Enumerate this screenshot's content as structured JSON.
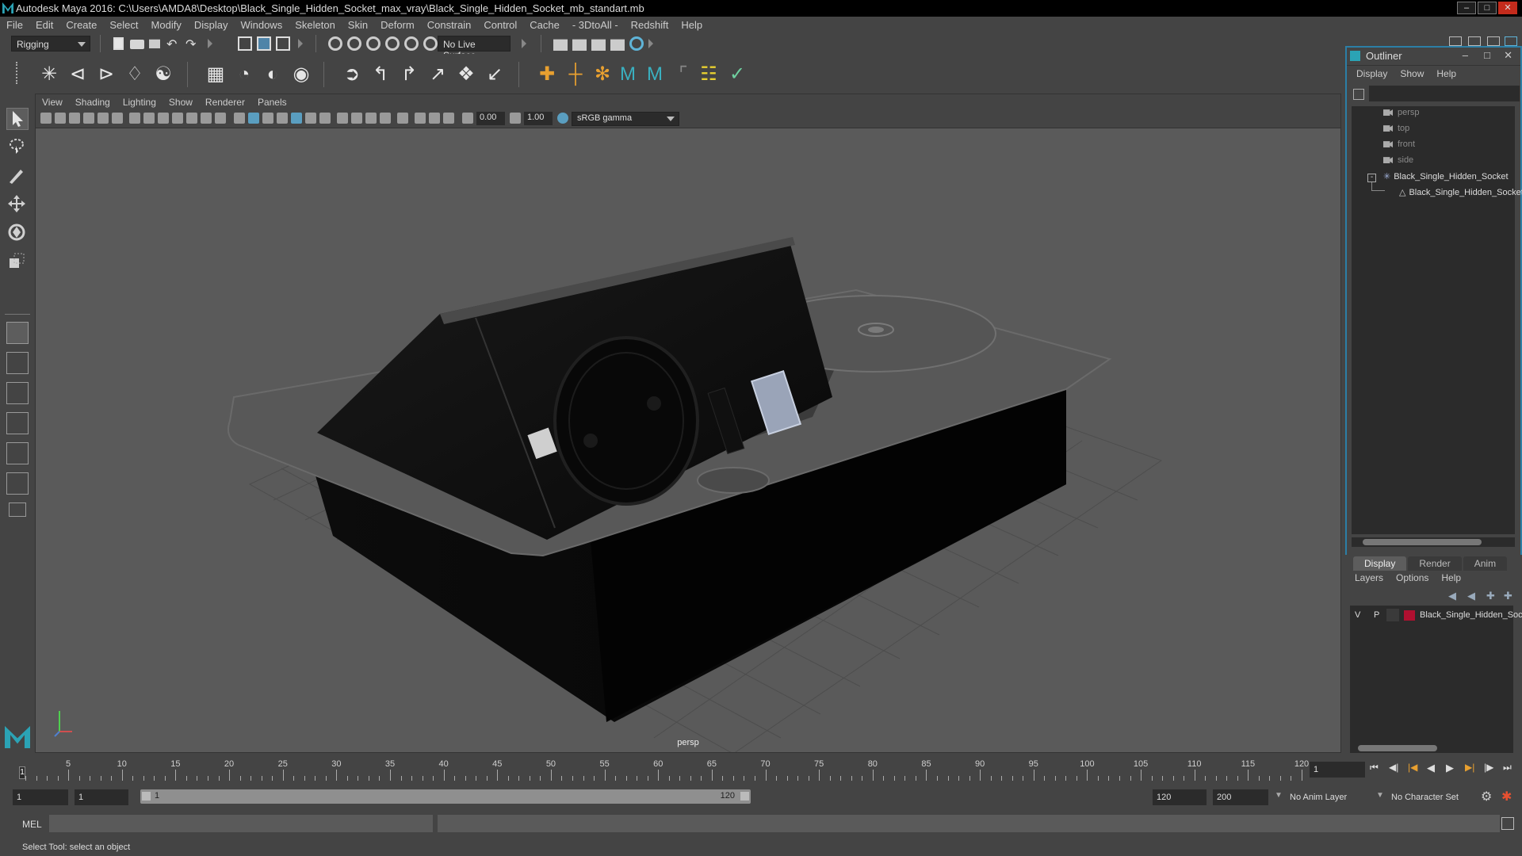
{
  "window": {
    "title": "Autodesk Maya 2016: C:\\Users\\AMDA8\\Desktop\\Black_Single_Hidden_Socket_max_vray\\Black_Single_Hidden_Socket_mb_standart.mb",
    "controls": [
      "–",
      "□",
      "✕"
    ]
  },
  "menubar": [
    "File",
    "Edit",
    "Create",
    "Select",
    "Modify",
    "Display",
    "Windows",
    "Skeleton",
    "Skin",
    "Deform",
    "Constrain",
    "Control",
    "Cache",
    "- 3DtoAll -",
    "Redshift",
    "Help"
  ],
  "statusline": {
    "menuset": "Rigging",
    "live_surface": "No Live Surface"
  },
  "viewport": {
    "menu": [
      "View",
      "Shading",
      "Lighting",
      "Show",
      "Renderer",
      "Panels"
    ],
    "exposure": "0.00",
    "gamma": "1.00",
    "colorspace": "sRGB gamma",
    "camera": "persp"
  },
  "outliner": {
    "title": "Outliner",
    "menu": [
      "Display",
      "Show",
      "Help"
    ],
    "items": [
      {
        "label": "persp",
        "dim": true
      },
      {
        "label": "top",
        "dim": true
      },
      {
        "label": "front",
        "dim": true
      },
      {
        "label": "side",
        "dim": true
      },
      {
        "label": "Black_Single_Hidden_Socket",
        "dim": false
      },
      {
        "label": "Black_Single_Hidden_Socket",
        "dim": false
      }
    ]
  },
  "layer_editor": {
    "tabs": [
      "Display",
      "Render",
      "Anim"
    ],
    "menu": [
      "Layers",
      "Options",
      "Help"
    ],
    "layer": {
      "v": "V",
      "p": "P",
      "name": "Black_Single_Hidden_Socket",
      "color": "#b01030"
    }
  },
  "timeline": {
    "ticks": [
      "5",
      "10",
      "15",
      "20",
      "25",
      "30",
      "35",
      "40",
      "45",
      "50",
      "55",
      "60",
      "65",
      "70",
      "75",
      "80",
      "85",
      "90",
      "95",
      "100",
      "105",
      "110",
      "115",
      "120"
    ],
    "current_frame": "1",
    "current_frame_field": "1"
  },
  "range": {
    "start": "1",
    "start_inner": "1",
    "range_start": "1",
    "range_end": "120",
    "end": "120",
    "end_total": "200",
    "anim_layer": "No Anim Layer",
    "char_set": "No Character Set"
  },
  "command": {
    "lang": "MEL"
  },
  "helpline": "Select Tool: select an object",
  "colors": {
    "bg": "#444444",
    "viewport": "#5a5a5a",
    "accent": "#2c7fa6"
  }
}
